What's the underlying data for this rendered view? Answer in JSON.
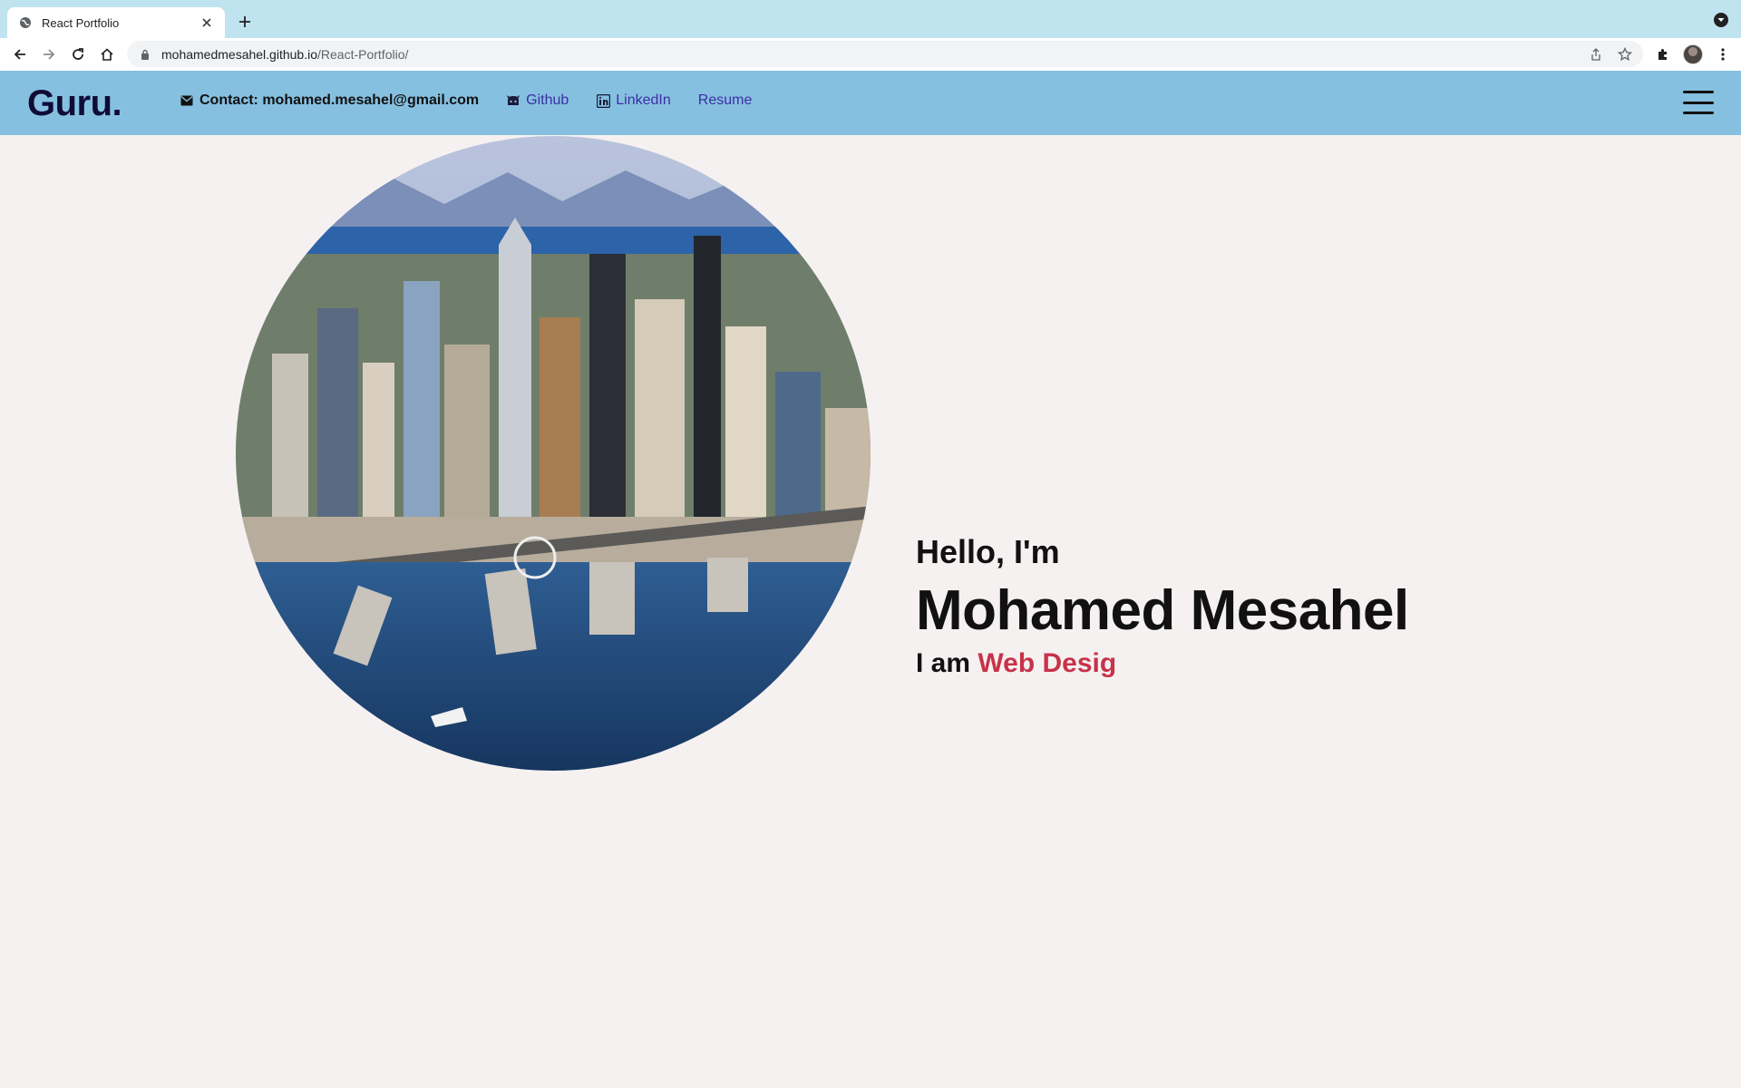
{
  "browser": {
    "tab_title": "React Portfolio",
    "url_host": "mohamedmesahel.github.io",
    "url_path": "/React-Portfolio/"
  },
  "site": {
    "logo": "Guru.",
    "nav": {
      "contact": "Contact: mohamed.mesahel@gmail.com",
      "github": "Github",
      "linkedin": "LinkedIn",
      "resume": "Resume"
    }
  },
  "hero": {
    "greeting": "Hello, I'm",
    "name": "Mohamed Mesahel",
    "role_prefix": "I am",
    "role_typed": "Web Desig"
  },
  "colors": {
    "header_bg": "#86c0e0",
    "page_bg": "#f6f1f1",
    "logo": "#0f0c35",
    "link": "#3a2fa3",
    "accent": "#c8324a"
  },
  "icons": [
    "globe-icon",
    "close-icon",
    "plus-icon",
    "back-icon",
    "forward-icon",
    "reload-icon",
    "home-icon",
    "lock-icon",
    "share-icon",
    "star-icon",
    "puzzle-icon",
    "mail-icon",
    "github-icon",
    "linkedin-icon",
    "hamburger-icon"
  ]
}
